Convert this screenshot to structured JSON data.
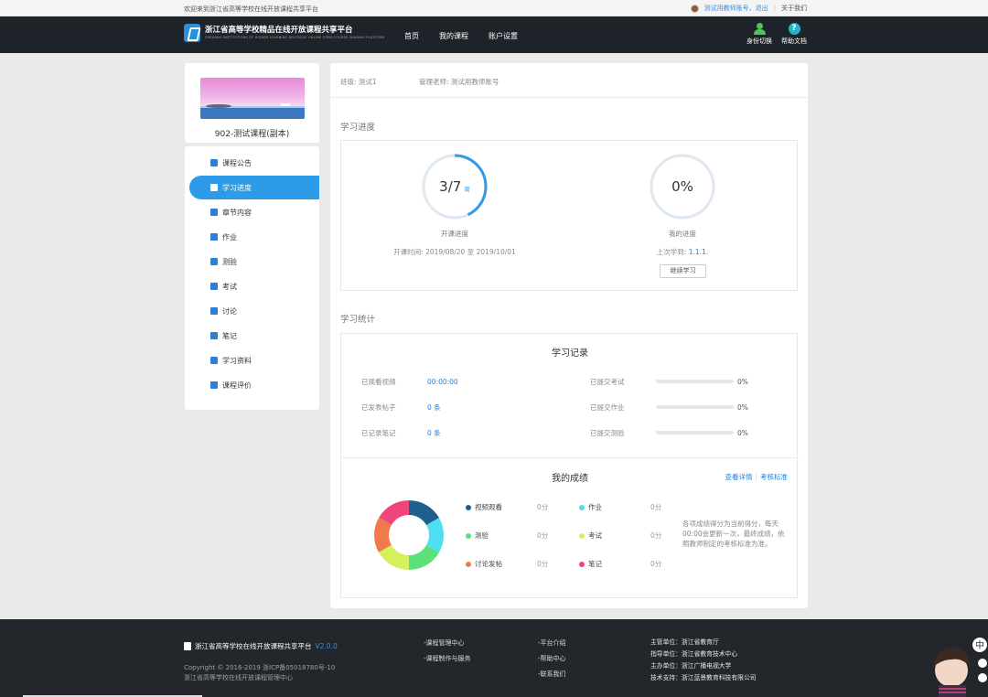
{
  "topbar": {
    "welcome": "欢迎来到浙江省高等学校在线开放课程共享平台",
    "user_link": "测试用教师账号，退出",
    "about": "关于我们"
  },
  "header": {
    "logo_title": "浙江省高等学校精品在线开放课程共享平台",
    "logo_subtitle": "ZHEJIANG INSTITUTIONS OF HIGHER LEARNING BOUTIQUE ONLINE OPEN COURSE SHARING PLATFORM",
    "nav": [
      "首页",
      "我的课程",
      "账户设置"
    ],
    "tools": [
      {
        "label": "身份切换",
        "icon": "user-switch-icon"
      },
      {
        "label": "帮助文档",
        "icon": "help-icon"
      }
    ]
  },
  "course": {
    "name": "902-测试课程(副本)"
  },
  "sidebar": {
    "items": [
      {
        "label": "课程公告",
        "icon": "bell-icon",
        "active": false
      },
      {
        "label": "学习进度",
        "icon": "progress-list-icon",
        "active": true
      },
      {
        "label": "章节内容",
        "icon": "chapter-icon",
        "active": false
      },
      {
        "label": "作业",
        "icon": "homework-icon",
        "active": false
      },
      {
        "label": "测验",
        "icon": "quiz-icon",
        "active": false
      },
      {
        "label": "考试",
        "icon": "exam-icon",
        "active": false
      },
      {
        "label": "讨论",
        "icon": "discussion-icon",
        "active": false
      },
      {
        "label": "笔记",
        "icon": "note-icon",
        "active": false
      },
      {
        "label": "学习资料",
        "icon": "materials-icon",
        "active": false
      },
      {
        "label": "课程评价",
        "icon": "star-icon",
        "active": false
      }
    ]
  },
  "main": {
    "class_label": "班级: 测试1",
    "teacher_label": "管理老师: 测试用教师账号",
    "progress_title": "学习进度",
    "course_progress": {
      "value": "3/7",
      "unit": "周",
      "fraction": 0.4286,
      "label": "开课进度",
      "period": "开课时间: 2019/08/20 至 2019/10/01"
    },
    "my_progress": {
      "value": "0%",
      "fraction": 0,
      "label": "我的进度",
      "last_learned_prefix": "上次学到: ",
      "last_learned": "1.1.1.",
      "continue_button": "继续学习"
    },
    "stats_title": "学习统计",
    "records": {
      "title": "学习记录",
      "left": [
        {
          "label": "已观看视频",
          "value": "00:00:00"
        },
        {
          "label": "已发表帖子",
          "value": "0 条"
        },
        {
          "label": "已记录笔记",
          "value": "0 条"
        }
      ],
      "right": [
        {
          "label": "已提交考试",
          "percent": 0,
          "text": "0%"
        },
        {
          "label": "已提交作业",
          "percent": 0,
          "text": "0%"
        },
        {
          "label": "已提交测验",
          "percent": 0,
          "text": "0%"
        }
      ]
    },
    "grades": {
      "title": "我的成绩",
      "link_detail": "查看详情",
      "link_standard": "考核标准",
      "note": "各项成绩得分为当前得分，每天00:00会更新一次，最终成绩，依照教师制定的考核标准为准。",
      "items": [
        {
          "label": "视频观看",
          "score": "0分",
          "color": "#1f5f8b"
        },
        {
          "label": "作业",
          "score": "0分",
          "color": "#4ee0f0"
        },
        {
          "label": "测验",
          "score": "0分",
          "color": "#5be07a"
        },
        {
          "label": "考试",
          "score": "0分",
          "color": "#d6f05a"
        },
        {
          "label": "讨论发帖",
          "score": "0分",
          "color": "#f07a4a"
        },
        {
          "label": "笔记",
          "score": "0分",
          "color": "#f0457a"
        }
      ]
    }
  },
  "footer": {
    "title": "浙江省高等学校在线开放课程共享平台",
    "version": "V2.0.0",
    "copyright": "Copyright © 2016-2019 浙ICP备05018780号-10",
    "management": "浙江省高等学校在线开放课程管理中心",
    "col1": [
      "-课程管理中心",
      "-课程制作与服务"
    ],
    "col2": [
      "-平台介绍",
      "-帮助中心",
      "-联系我们"
    ],
    "info": [
      "主管单位：浙江省教育厅",
      "指导单位：浙江省教育技术中心",
      "主办单位：浙江广播电视大学",
      "技术支持：浙江蓝景教育科技有限公司"
    ],
    "mascot_badge": "中"
  }
}
